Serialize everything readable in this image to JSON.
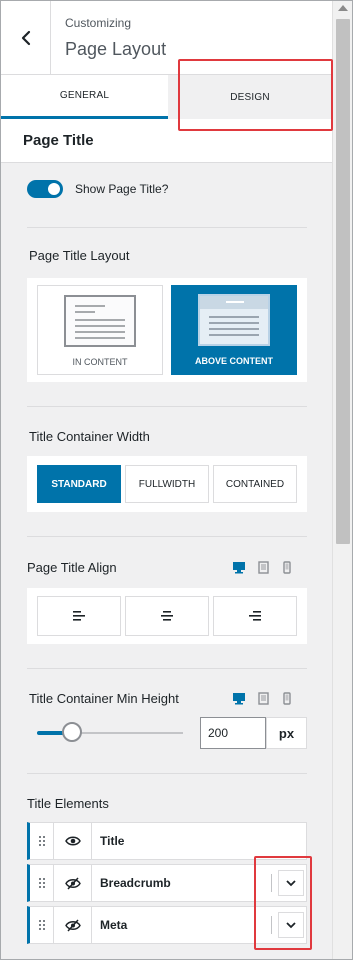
{
  "header": {
    "breadcrumb": "Customizing",
    "title": "Page Layout"
  },
  "tabs": [
    {
      "label": "GENERAL",
      "active": true
    },
    {
      "label": "DESIGN",
      "active": false
    }
  ],
  "section_title": "Page Title",
  "show_title": {
    "label": "Show Page Title?",
    "enabled": true
  },
  "layout": {
    "label": "Page Title Layout",
    "options": [
      {
        "label": "IN CONTENT",
        "selected": false
      },
      {
        "label": "ABOVE CONTENT",
        "selected": true
      }
    ]
  },
  "width": {
    "label": "Title Container Width",
    "options": [
      {
        "label": "STANDARD",
        "selected": true
      },
      {
        "label": "FULLWIDTH",
        "selected": false
      },
      {
        "label": "CONTAINED",
        "selected": false
      }
    ]
  },
  "align": {
    "label": "Page Title Align",
    "options": [
      "left",
      "center",
      "right"
    ]
  },
  "min_height": {
    "label": "Title Container Min Height",
    "value": "200",
    "unit": "px",
    "slider_fraction": 0.24
  },
  "devices": [
    "desktop-icon",
    "tablet-icon",
    "mobile-icon"
  ],
  "elements": {
    "label": "Title Elements",
    "items": [
      {
        "name": "Title",
        "visible": true,
        "expandable": false
      },
      {
        "name": "Breadcrumb",
        "visible": false,
        "expandable": true
      },
      {
        "name": "Meta",
        "visible": false,
        "expandable": true
      }
    ]
  },
  "colors": {
    "accent": "#0073aa",
    "highlight": "#e0393e"
  }
}
